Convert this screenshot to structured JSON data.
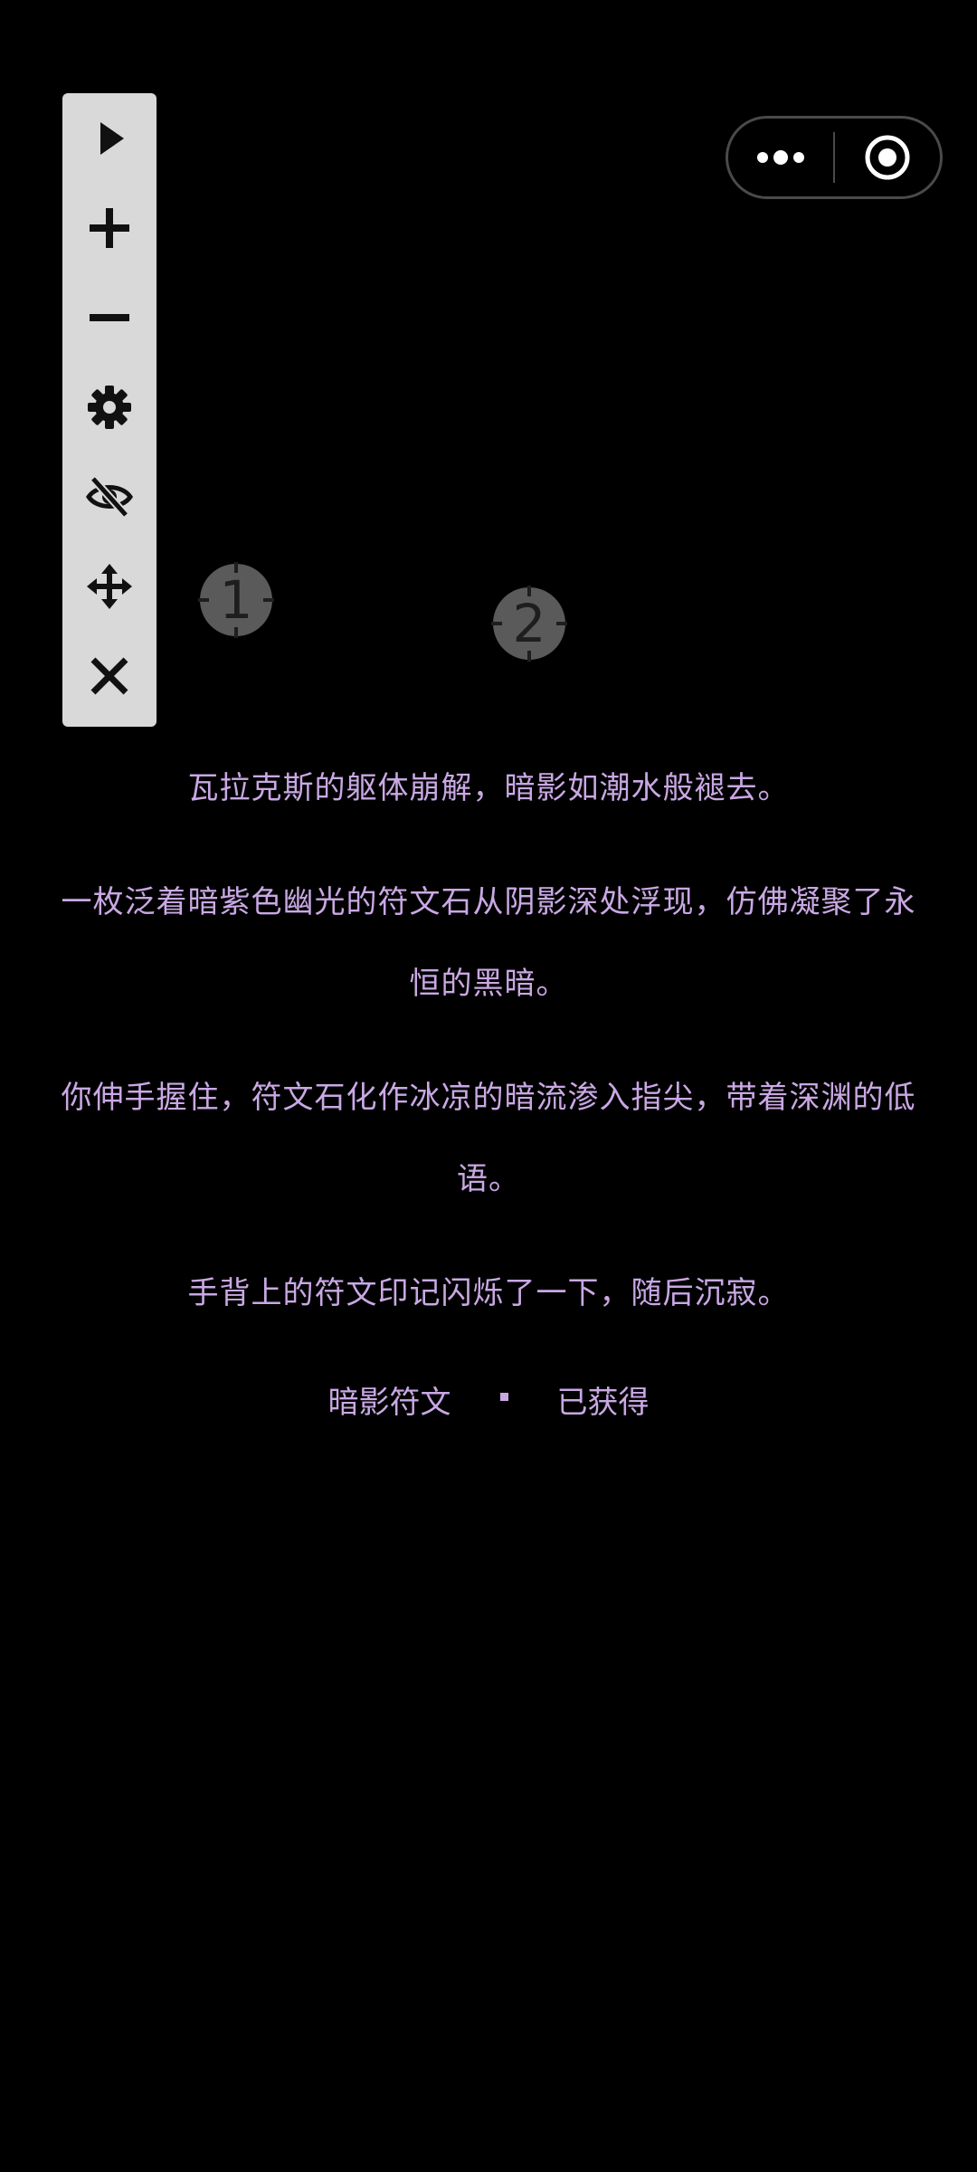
{
  "toolbar": {
    "buttons": [
      {
        "name": "play-button",
        "icon": "play-icon"
      },
      {
        "name": "zoom-in-button",
        "icon": "plus-icon"
      },
      {
        "name": "zoom-out-button",
        "icon": "minus-icon"
      },
      {
        "name": "settings-button",
        "icon": "gear-icon"
      },
      {
        "name": "hide-button",
        "icon": "eye-off-icon"
      },
      {
        "name": "move-button",
        "icon": "move-icon"
      },
      {
        "name": "close-button",
        "icon": "close-icon"
      }
    ]
  },
  "capsule": {
    "more_icon": "more-dots-icon",
    "exit_icon": "target-icon"
  },
  "markers": {
    "first": "1",
    "second": "2"
  },
  "story": {
    "line1": "瓦拉克斯的躯体崩解，暗影如潮水般褪去。",
    "line2a": "一枚泛着暗紫色幽光的符文石从阴影深处浮现，仿佛凝聚了永",
    "line2b": "恒的黑暗。",
    "line3a": "你伸手握住，符文石化作冰凉的暗流渗入指尖，带着深渊的低",
    "line3b": "语。",
    "line4": "手背上的符文印记闪烁了一下，随后沉寂。"
  },
  "reward": {
    "item": "暗影符文",
    "status": "已获得"
  },
  "colors": {
    "background": "#000000",
    "text": "#c9a8e4",
    "toolbar": "#d9d9d9",
    "marker": "#5a5a5a"
  }
}
